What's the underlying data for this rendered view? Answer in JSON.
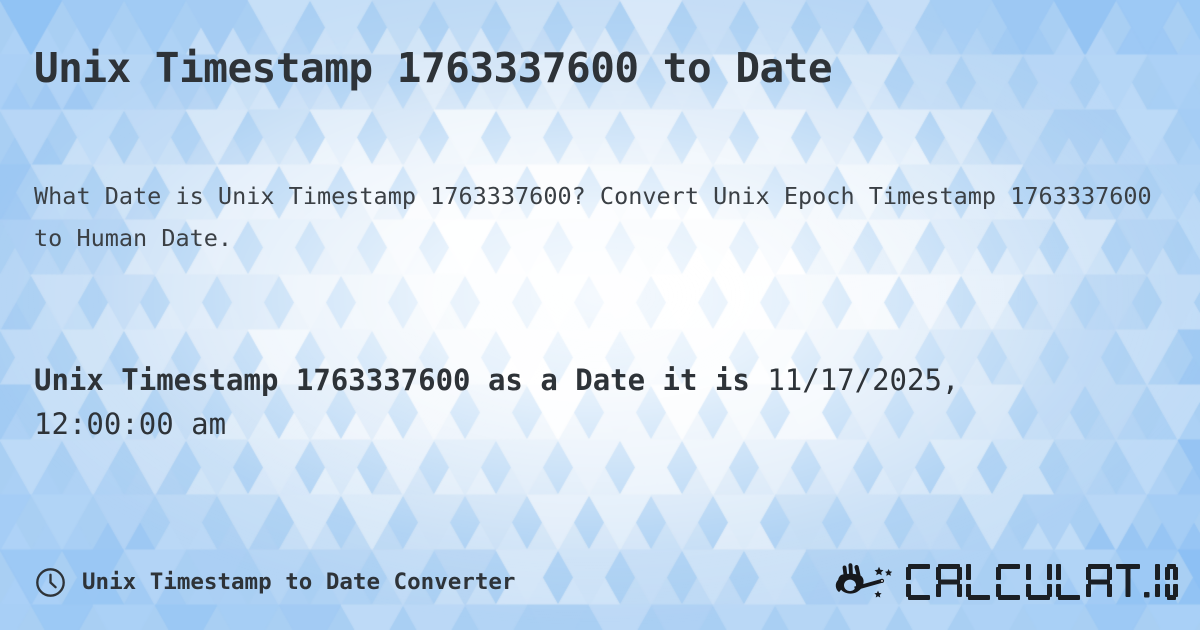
{
  "meta": {
    "timestamp": "1763337600",
    "text_color": "#2e3338",
    "background_color": "#a9cff3",
    "accent_color": "#2e3338"
  },
  "header": {
    "title": "Unix Timestamp 1763337600 to Date"
  },
  "description": {
    "text": "What Date is Unix Timestamp 1763337600? Convert Unix Epoch Timestamp 1763337600 to Human Date."
  },
  "result": {
    "lead": "Unix Timestamp 1763337600 as a Date it is",
    "value": "11/17/2025, 12:00:00 am",
    "date": "11/17/2025",
    "time": "12:00:00 am"
  },
  "footer": {
    "icon": "clock-icon",
    "label": "Unix Timestamp to Date Converter",
    "brand": {
      "icon": "magic-wand-hand-icon",
      "name": "CALCULAT.IO"
    }
  }
}
